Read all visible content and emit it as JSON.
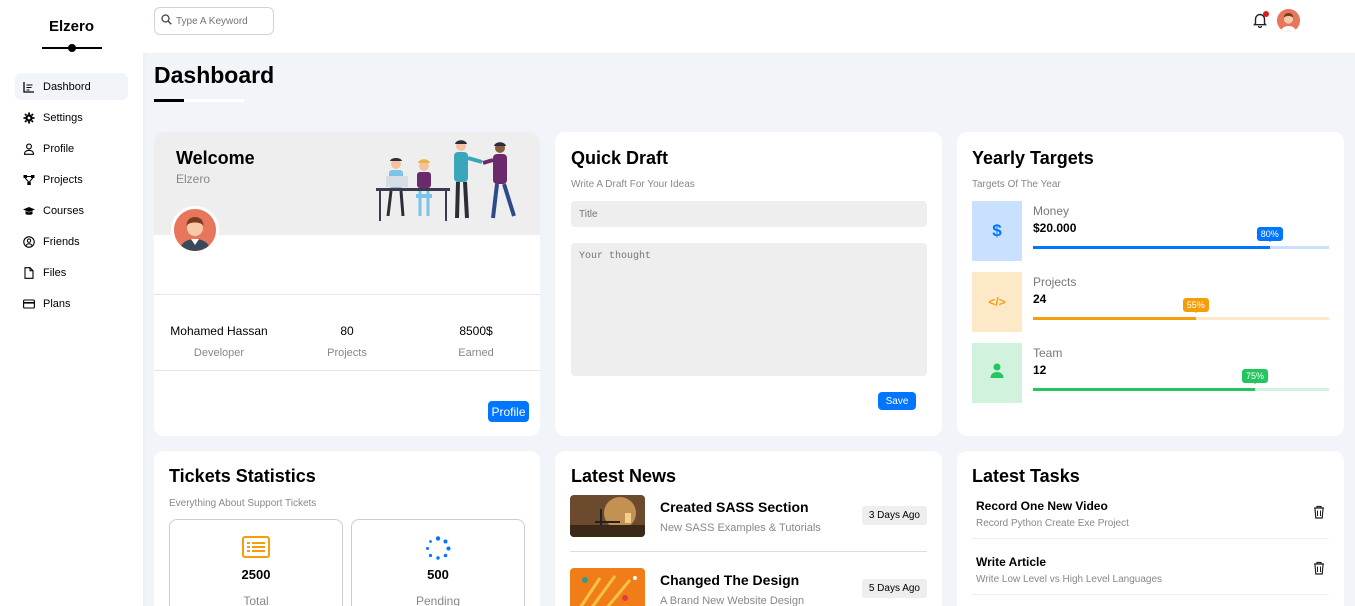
{
  "brand": "Elzero",
  "sidebar": {
    "items": [
      {
        "label": "Dashbord",
        "icon": "chart-line-icon"
      },
      {
        "label": "Settings",
        "icon": "gear-icon"
      },
      {
        "label": "Profile",
        "icon": "user-icon"
      },
      {
        "label": "Projects",
        "icon": "diagram-icon"
      },
      {
        "label": "Courses",
        "icon": "graduation-cap-icon"
      },
      {
        "label": "Friends",
        "icon": "user-circle-icon"
      },
      {
        "label": "Files",
        "icon": "file-icon"
      },
      {
        "label": "Plans",
        "icon": "credit-card-icon"
      }
    ]
  },
  "header": {
    "search_placeholder": "Type A Keyword"
  },
  "page_title": "Dashboard",
  "welcome": {
    "title": "Welcome",
    "subtitle": "Elzero",
    "name": "Mohamed Hassan",
    "role": "Developer",
    "projects_value": "80",
    "projects_label": "Projects",
    "earned_value": "8500$",
    "earned_label": "Earned",
    "profile_button": "Profile"
  },
  "quick_draft": {
    "title": "Quick Draft",
    "subtitle": "Write A Draft For Your Ideas",
    "title_placeholder": "Title",
    "thought_placeholder": "Your thought",
    "save_button": "Save"
  },
  "yearly_targets": {
    "title": "Yearly Targets",
    "subtitle": "Targets Of The Year",
    "items": [
      {
        "name": "Money",
        "value": "$20.000",
        "percent_label": "80%",
        "percent": 80,
        "color": "#0075ff",
        "bg": "#c9e1ff",
        "icon": "dollar-icon",
        "icon_text": "$"
      },
      {
        "name": "Projects",
        "value": "24",
        "percent_label": "55%",
        "percent": 55,
        "color": "#f59e0b",
        "bg": "#fde8c8",
        "icon": "code-icon",
        "icon_text": "</>"
      },
      {
        "name": "Team",
        "value": "12",
        "percent_label": "75%",
        "percent": 75,
        "color": "#22c55e",
        "bg": "#d1f2dc",
        "icon": "user-icon",
        "icon_text": ""
      }
    ]
  },
  "tickets": {
    "title": "Tickets Statistics",
    "subtitle": "Everything About Support Tickets",
    "items": [
      {
        "value": "2500",
        "label": "Total",
        "icon": "list-icon",
        "color": "#f59e0b"
      },
      {
        "value": "500",
        "label": "Pending",
        "icon": "spinner-icon",
        "color": "#0075ff"
      }
    ]
  },
  "news": {
    "title": "Latest News",
    "items": [
      {
        "title": "Created SASS Section",
        "desc": "New SASS Examples & Tutorials",
        "date": "3 Days Ago"
      },
      {
        "title": "Changed The Design",
        "desc": "A Brand New Website Design",
        "date": "5 Days Ago"
      }
    ]
  },
  "tasks": {
    "title": "Latest Tasks",
    "items": [
      {
        "title": "Record One New Video",
        "desc": "Record Python Create Exe Project"
      },
      {
        "title": "Write Article",
        "desc": "Write Low Level vs High Level Languages"
      }
    ]
  }
}
